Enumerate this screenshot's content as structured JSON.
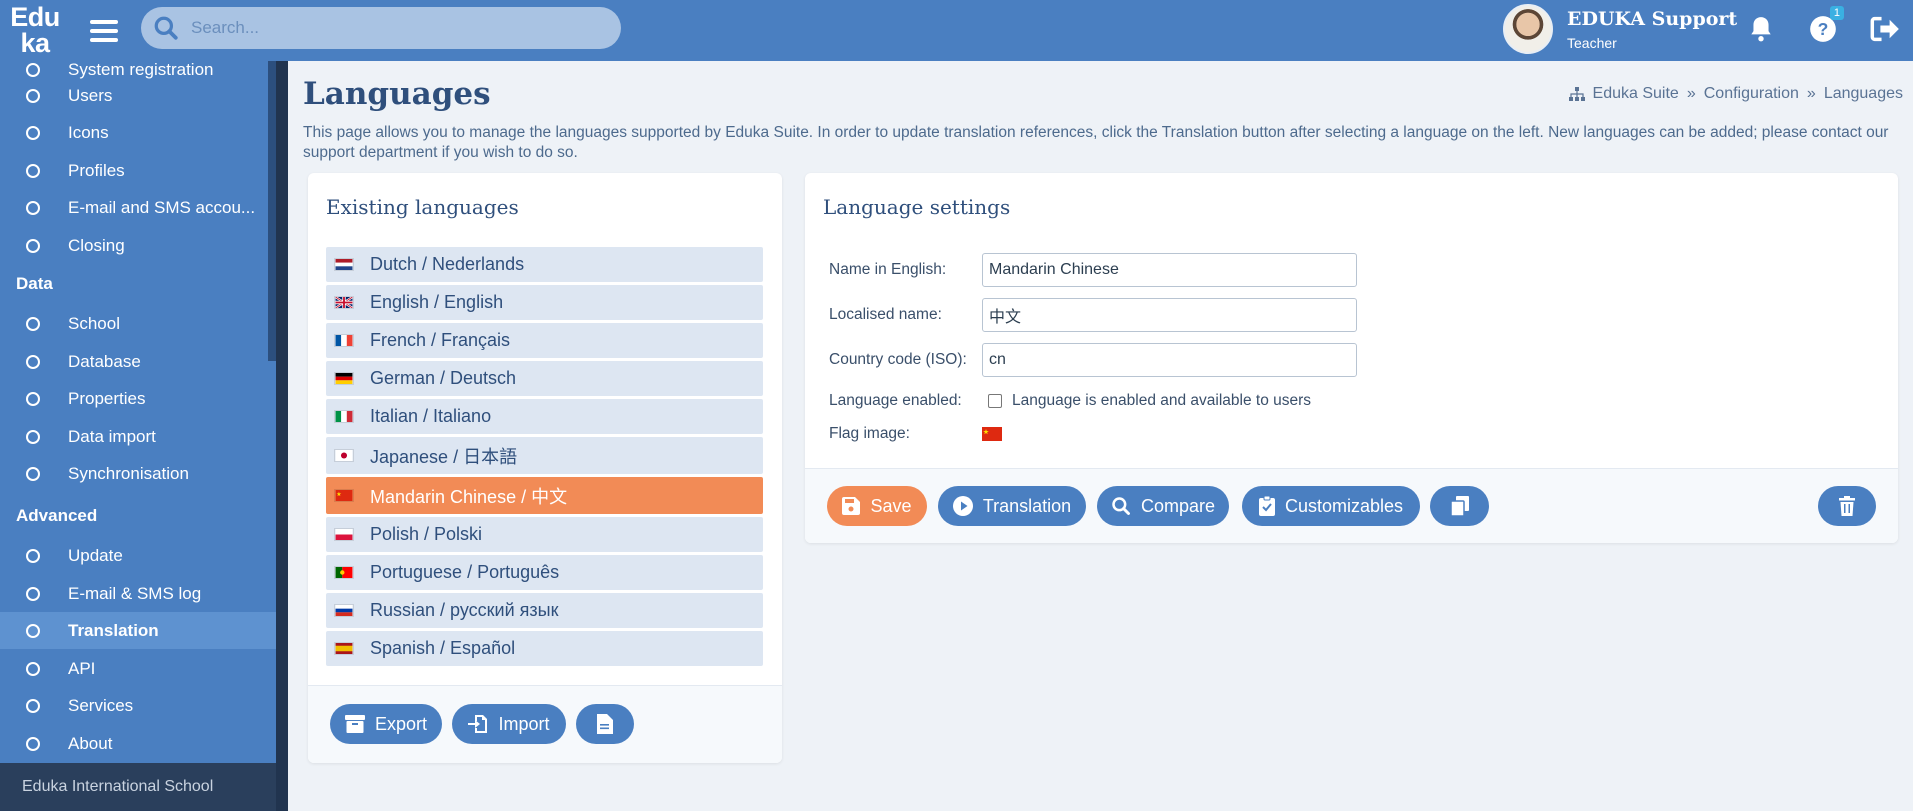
{
  "logo": {
    "line1": "Edu",
    "line2": "ka"
  },
  "search": {
    "placeholder": "Search..."
  },
  "user": {
    "name": "EDUKA Support",
    "role": "Teacher"
  },
  "help_badge": "1",
  "sidebar": {
    "partial_item": "System registration",
    "items_top": [
      "Users",
      "Icons",
      "Profiles",
      "E-mail and SMS accou...",
      "Closing"
    ],
    "section_data": "Data",
    "items_data": [
      "School",
      "Database",
      "Properties",
      "Data import",
      "Synchronisation"
    ],
    "section_advanced": "Advanced",
    "items_advanced": [
      "Update",
      "E-mail & SMS log",
      "Translation",
      "API",
      "Services",
      "About"
    ],
    "active_item": "Translation",
    "footer": "Eduka International School"
  },
  "page": {
    "title": "Languages",
    "breadcrumb": [
      "Eduka Suite",
      "»",
      "Configuration",
      "»",
      "Languages"
    ],
    "intro": "This page allows you to manage the languages supported by Eduka Suite. In order to update translation references, click the Translation button after selecting a language on the left. New languages can be added; please contact our support department if you wish to do so."
  },
  "existing": {
    "title": "Existing languages",
    "languages": [
      {
        "label": "Dutch / Nederlands",
        "flag": "nl"
      },
      {
        "label": "English / English",
        "flag": "gb"
      },
      {
        "label": "French / Français",
        "flag": "fr"
      },
      {
        "label": "German / Deutsch",
        "flag": "de"
      },
      {
        "label": "Italian / Italiano",
        "flag": "it"
      },
      {
        "label": "Japanese / 日本語",
        "flag": "jp"
      },
      {
        "label": "Mandarin Chinese / 中文",
        "flag": "cn"
      },
      {
        "label": "Polish / Polski",
        "flag": "pl"
      },
      {
        "label": "Portuguese / Português",
        "flag": "pt"
      },
      {
        "label": "Russian / русский язык",
        "flag": "ru"
      },
      {
        "label": "Spanish / Español",
        "flag": "es"
      }
    ],
    "selected_index": 6,
    "buttons": {
      "export": "Export",
      "import": "Import"
    }
  },
  "settings": {
    "title": "Language settings",
    "name_en_label": "Name in English:",
    "name_en_value": "Mandarin Chinese",
    "localised_label": "Localised name:",
    "localised_value": "中文",
    "country_label": "Country code (ISO):",
    "country_value": "cn",
    "enabled_label": "Language enabled:",
    "enabled_text": "Language is enabled and available to users",
    "enabled_checked": false,
    "flag_label": "Flag image:",
    "buttons": {
      "save": "Save",
      "translation": "Translation",
      "compare": "Compare",
      "customizables": "Customizables"
    }
  },
  "colors": {
    "primary": "#4a7fc1",
    "accent": "#f28b56",
    "sidebar_active": "#5e92d0",
    "sidebar_footer": "#2a3f5c"
  }
}
